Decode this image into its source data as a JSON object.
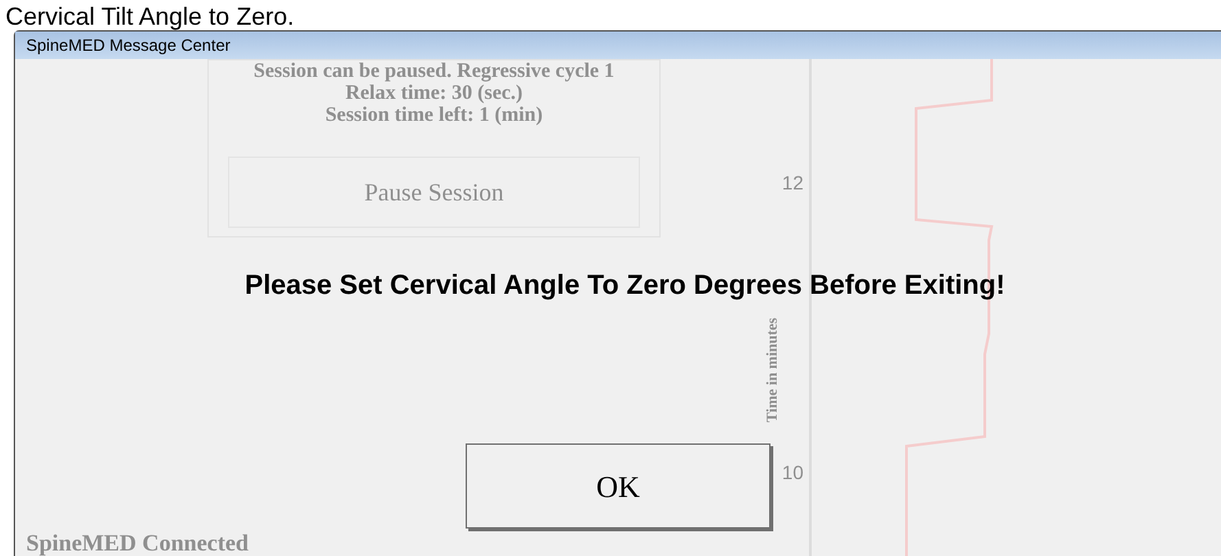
{
  "caption": "Cervical Tilt Angle to Zero.",
  "background": {
    "session_info": [
      "Session can be paused. Regressive cycle 1",
      "Relax time: 30 (sec.)",
      "Session time left: 1 (min)"
    ],
    "pause_button": "Pause Session",
    "axis_label": "Time in minutes",
    "ticks": [
      "12",
      "10"
    ],
    "status": "SpineMED Connected"
  },
  "dialog": {
    "title": "SpineMED Message Center",
    "message": "Please Set Cervical Angle To Zero Degrees Before Exiting!",
    "buttons": [
      "OK"
    ]
  }
}
